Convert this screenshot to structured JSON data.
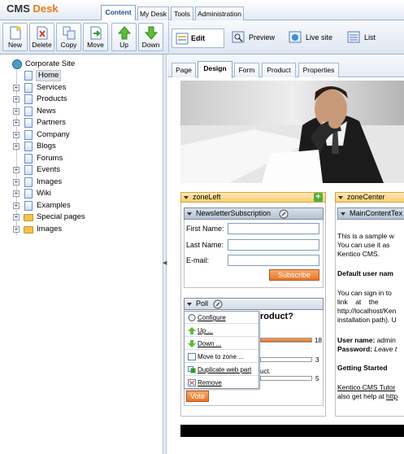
{
  "app": {
    "title_cms": "CMS",
    "title_desk": "Desk"
  },
  "top_tabs": [
    {
      "label": "Content",
      "active": true
    },
    {
      "label": "My Desk",
      "active": false
    },
    {
      "label": "Tools",
      "active": false
    },
    {
      "label": "Administration",
      "active": false
    }
  ],
  "toolbar": {
    "new": "New",
    "delete": "Delete",
    "copy": "Copy",
    "move": "Move",
    "up": "Up",
    "down": "Down",
    "edit": "Edit",
    "preview": "Preview",
    "live_site": "Live site",
    "list": "List"
  },
  "tree": {
    "root": "Corporate Site",
    "items": [
      "Home",
      "Services",
      "Products",
      "News",
      "Partners",
      "Company",
      "Blogs",
      "Forums",
      "Events",
      "Images",
      "Wiki",
      "Examples",
      "Special pages",
      "Images"
    ]
  },
  "sub_tabs": [
    "Page",
    "Design",
    "Form",
    "Product",
    "Properties"
  ],
  "zones": {
    "left": "zoneLeft",
    "center": "zoneCenter"
  },
  "newsletter": {
    "title": "NewsletterSubscription",
    "first_name": "First Name:",
    "last_name": "Last Name:",
    "email": "E-mail:",
    "subscribe": "Subscribe"
  },
  "poll": {
    "title": "Poll",
    "question": "roduct?",
    "fragment": "uct.",
    "counts": [
      "18",
      "3",
      "5"
    ],
    "vote": "Vote",
    "menu": [
      "Configure",
      "Up ...",
      "Down ...",
      "Move to zone ...",
      "Duplicate web part",
      "Remove"
    ]
  },
  "main_content": {
    "title": "MainContentTex",
    "p1": [
      "This is a sample w",
      "You can use it as",
      "Kentico CMS."
    ],
    "default_user": "Default user nam",
    "p2": [
      "You can sign in to",
      "link    at    the",
      "http://localhost/Ken",
      "installation path). U"
    ],
    "user_name_label": "User name:",
    "user_name_val": "admin",
    "password_label": "Password:",
    "password_val": "Leave t",
    "getting_started": "Getting Started",
    "p3a": "Kentico CMS Tutor",
    "p3b": "also get help at ",
    "p3c": "http"
  },
  "colors": {
    "accent": "#e87b14",
    "tab_border": "#9db3cf",
    "zone_header": "#f8cf73",
    "button_orange": "#e8762a"
  }
}
